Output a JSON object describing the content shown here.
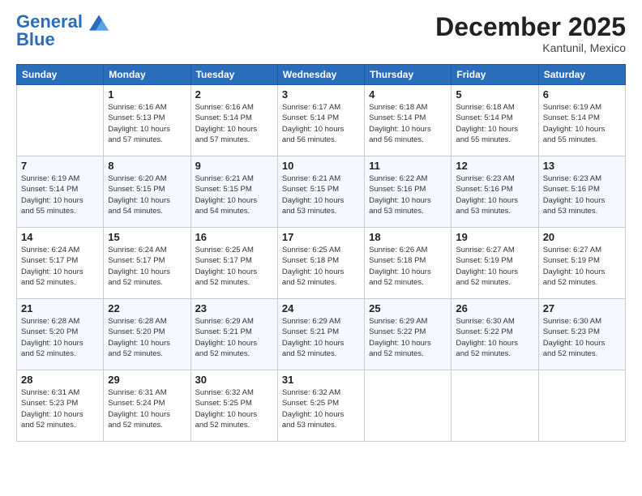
{
  "header": {
    "logo_general": "General",
    "logo_blue": "Blue",
    "month_title": "December 2025",
    "subtitle": "Kantunil, Mexico"
  },
  "weekdays": [
    "Sunday",
    "Monday",
    "Tuesday",
    "Wednesday",
    "Thursday",
    "Friday",
    "Saturday"
  ],
  "weeks": [
    [
      {
        "day": "",
        "info": ""
      },
      {
        "day": "1",
        "info": "Sunrise: 6:16 AM\nSunset: 5:13 PM\nDaylight: 10 hours\nand 57 minutes."
      },
      {
        "day": "2",
        "info": "Sunrise: 6:16 AM\nSunset: 5:14 PM\nDaylight: 10 hours\nand 57 minutes."
      },
      {
        "day": "3",
        "info": "Sunrise: 6:17 AM\nSunset: 5:14 PM\nDaylight: 10 hours\nand 56 minutes."
      },
      {
        "day": "4",
        "info": "Sunrise: 6:18 AM\nSunset: 5:14 PM\nDaylight: 10 hours\nand 56 minutes."
      },
      {
        "day": "5",
        "info": "Sunrise: 6:18 AM\nSunset: 5:14 PM\nDaylight: 10 hours\nand 55 minutes."
      },
      {
        "day": "6",
        "info": "Sunrise: 6:19 AM\nSunset: 5:14 PM\nDaylight: 10 hours\nand 55 minutes."
      }
    ],
    [
      {
        "day": "7",
        "info": "Sunrise: 6:19 AM\nSunset: 5:14 PM\nDaylight: 10 hours\nand 55 minutes."
      },
      {
        "day": "8",
        "info": "Sunrise: 6:20 AM\nSunset: 5:15 PM\nDaylight: 10 hours\nand 54 minutes."
      },
      {
        "day": "9",
        "info": "Sunrise: 6:21 AM\nSunset: 5:15 PM\nDaylight: 10 hours\nand 54 minutes."
      },
      {
        "day": "10",
        "info": "Sunrise: 6:21 AM\nSunset: 5:15 PM\nDaylight: 10 hours\nand 53 minutes."
      },
      {
        "day": "11",
        "info": "Sunrise: 6:22 AM\nSunset: 5:16 PM\nDaylight: 10 hours\nand 53 minutes."
      },
      {
        "day": "12",
        "info": "Sunrise: 6:23 AM\nSunset: 5:16 PM\nDaylight: 10 hours\nand 53 minutes."
      },
      {
        "day": "13",
        "info": "Sunrise: 6:23 AM\nSunset: 5:16 PM\nDaylight: 10 hours\nand 53 minutes."
      }
    ],
    [
      {
        "day": "14",
        "info": "Sunrise: 6:24 AM\nSunset: 5:17 PM\nDaylight: 10 hours\nand 52 minutes."
      },
      {
        "day": "15",
        "info": "Sunrise: 6:24 AM\nSunset: 5:17 PM\nDaylight: 10 hours\nand 52 minutes."
      },
      {
        "day": "16",
        "info": "Sunrise: 6:25 AM\nSunset: 5:17 PM\nDaylight: 10 hours\nand 52 minutes."
      },
      {
        "day": "17",
        "info": "Sunrise: 6:25 AM\nSunset: 5:18 PM\nDaylight: 10 hours\nand 52 minutes."
      },
      {
        "day": "18",
        "info": "Sunrise: 6:26 AM\nSunset: 5:18 PM\nDaylight: 10 hours\nand 52 minutes."
      },
      {
        "day": "19",
        "info": "Sunrise: 6:27 AM\nSunset: 5:19 PM\nDaylight: 10 hours\nand 52 minutes."
      },
      {
        "day": "20",
        "info": "Sunrise: 6:27 AM\nSunset: 5:19 PM\nDaylight: 10 hours\nand 52 minutes."
      }
    ],
    [
      {
        "day": "21",
        "info": "Sunrise: 6:28 AM\nSunset: 5:20 PM\nDaylight: 10 hours\nand 52 minutes."
      },
      {
        "day": "22",
        "info": "Sunrise: 6:28 AM\nSunset: 5:20 PM\nDaylight: 10 hours\nand 52 minutes."
      },
      {
        "day": "23",
        "info": "Sunrise: 6:29 AM\nSunset: 5:21 PM\nDaylight: 10 hours\nand 52 minutes."
      },
      {
        "day": "24",
        "info": "Sunrise: 6:29 AM\nSunset: 5:21 PM\nDaylight: 10 hours\nand 52 minutes."
      },
      {
        "day": "25",
        "info": "Sunrise: 6:29 AM\nSunset: 5:22 PM\nDaylight: 10 hours\nand 52 minutes."
      },
      {
        "day": "26",
        "info": "Sunrise: 6:30 AM\nSunset: 5:22 PM\nDaylight: 10 hours\nand 52 minutes."
      },
      {
        "day": "27",
        "info": "Sunrise: 6:30 AM\nSunset: 5:23 PM\nDaylight: 10 hours\nand 52 minutes."
      }
    ],
    [
      {
        "day": "28",
        "info": "Sunrise: 6:31 AM\nSunset: 5:23 PM\nDaylight: 10 hours\nand 52 minutes."
      },
      {
        "day": "29",
        "info": "Sunrise: 6:31 AM\nSunset: 5:24 PM\nDaylight: 10 hours\nand 52 minutes."
      },
      {
        "day": "30",
        "info": "Sunrise: 6:32 AM\nSunset: 5:25 PM\nDaylight: 10 hours\nand 52 minutes."
      },
      {
        "day": "31",
        "info": "Sunrise: 6:32 AM\nSunset: 5:25 PM\nDaylight: 10 hours\nand 53 minutes."
      },
      {
        "day": "",
        "info": ""
      },
      {
        "day": "",
        "info": ""
      },
      {
        "day": "",
        "info": ""
      }
    ]
  ]
}
